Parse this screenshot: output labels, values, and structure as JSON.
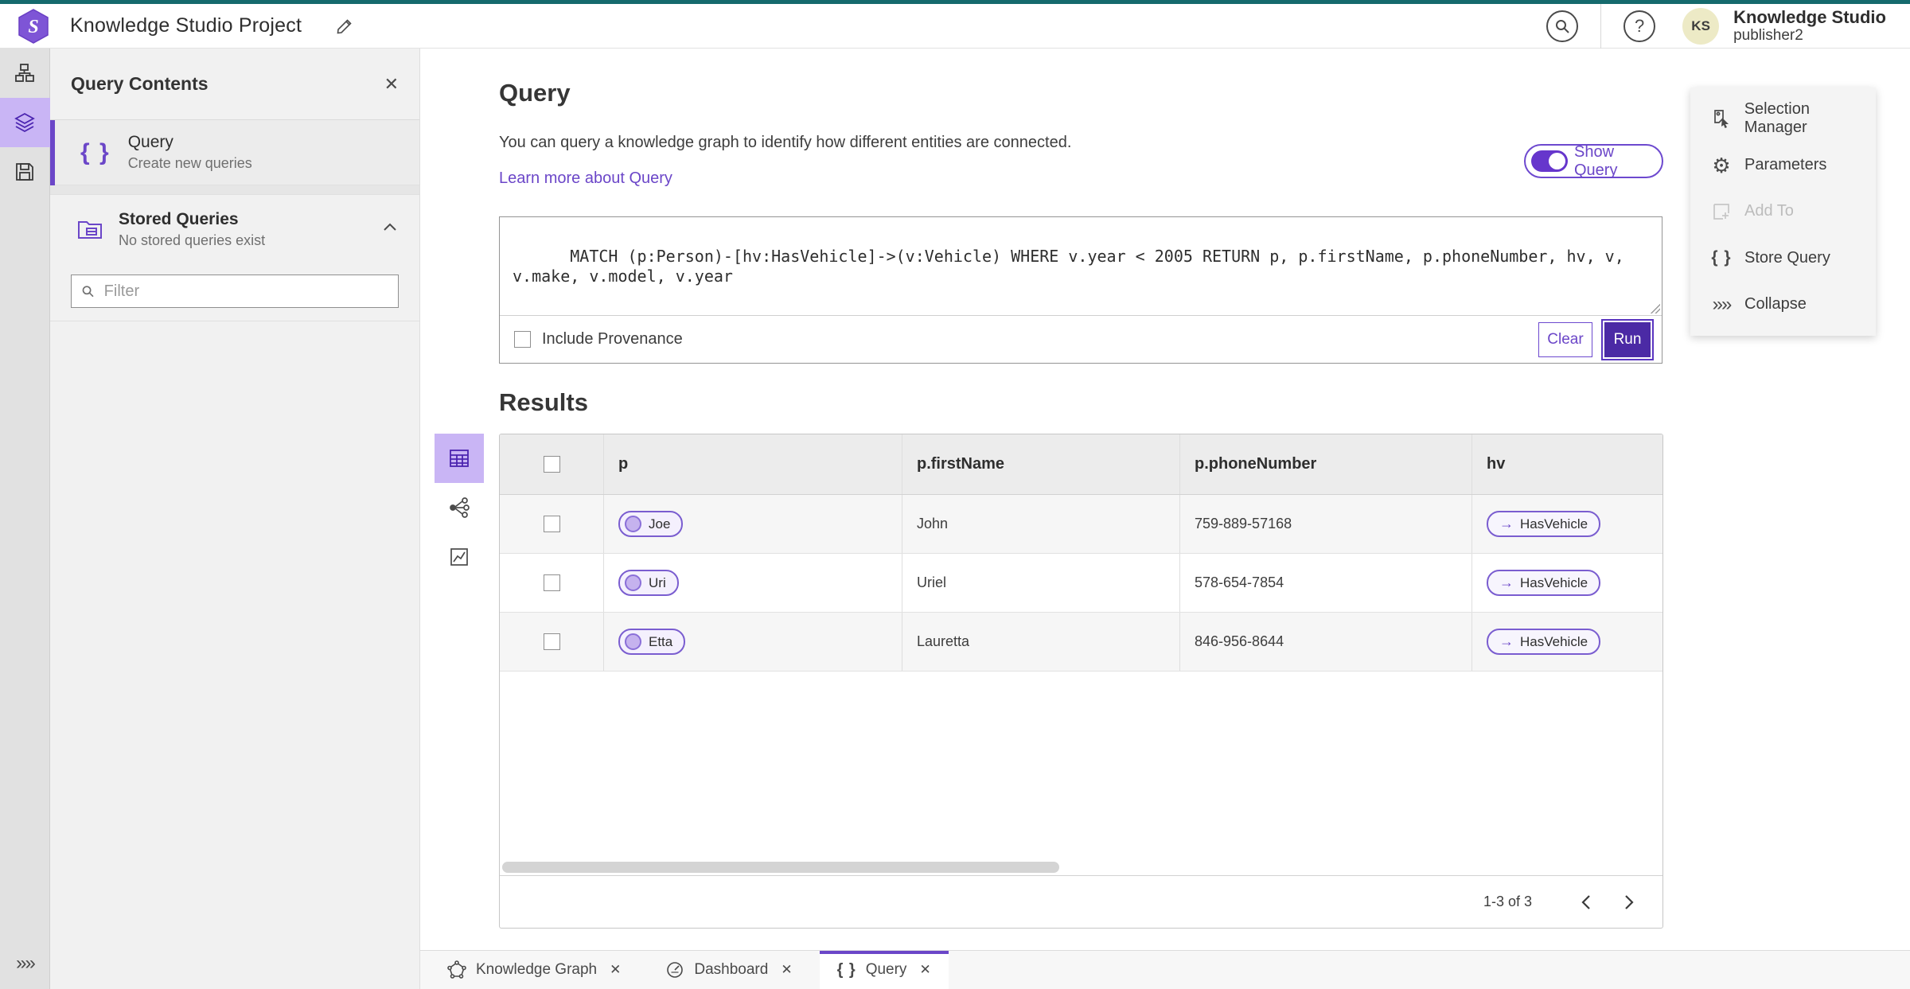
{
  "header": {
    "app_title": "Knowledge Studio Project",
    "user_name": "Knowledge Studio",
    "user_role": "publisher2",
    "avatar_initials": "KS",
    "help_glyph": "?"
  },
  "sidebar_panel": {
    "title": "Query Contents",
    "close_glyph": "✕",
    "query_item": {
      "title": "Query",
      "subtitle": "Create new queries",
      "icon_glyph": "{ }"
    },
    "stored_queries": {
      "title": "Stored Queries",
      "subtitle": "No stored queries exist"
    },
    "filter_placeholder": "Filter"
  },
  "query_section": {
    "title": "Query",
    "description": "You can query a knowledge graph to identify how different entities are connected.",
    "learn_more": "Learn more about Query",
    "show_query_label": "Show Query",
    "query_text": "MATCH (p:Person)-[hv:HasVehicle]->(v:Vehicle) WHERE v.year < 2005 RETURN p, p.firstName, p.phoneNumber, hv, v, v.make, v.model, v.year",
    "include_provenance_label": "Include Provenance",
    "clear_label": "Clear",
    "run_label": "Run"
  },
  "results": {
    "title": "Results",
    "columns": [
      "p",
      "p.firstName",
      "p.phoneNumber",
      "hv"
    ],
    "rows": [
      {
        "p": "Joe",
        "firstName": "John",
        "phoneNumber": "759-889-57168",
        "hv": "HasVehicle"
      },
      {
        "p": "Uri",
        "firstName": "Uriel",
        "phoneNumber": "578-654-7854",
        "hv": "HasVehicle"
      },
      {
        "p": "Etta",
        "firstName": "Lauretta",
        "phoneNumber": "846-956-8644",
        "hv": "HasVehicle"
      }
    ],
    "edge_arrow_glyph": "→",
    "pagination": "1-3 of 3"
  },
  "actions_panel": {
    "items": [
      {
        "label": "Selection Manager"
      },
      {
        "label": "Parameters"
      },
      {
        "label": "Add To"
      },
      {
        "label": "Store Query"
      },
      {
        "label": "Collapse"
      }
    ]
  },
  "tabs": [
    {
      "label": "Knowledge Graph",
      "close_glyph": "✕"
    },
    {
      "label": "Dashboard",
      "close_glyph": "✕"
    },
    {
      "label": "Query",
      "close_glyph": "✕",
      "icon_glyph": "{ }"
    }
  ],
  "colors": {
    "top_accent_teal": "#156a6d",
    "accent_purple": "#6b46c8",
    "run_button_purple": "#4b2aa5",
    "selected_light_purple": "#c9b5f5",
    "avatar_bg": "#edeac6"
  }
}
